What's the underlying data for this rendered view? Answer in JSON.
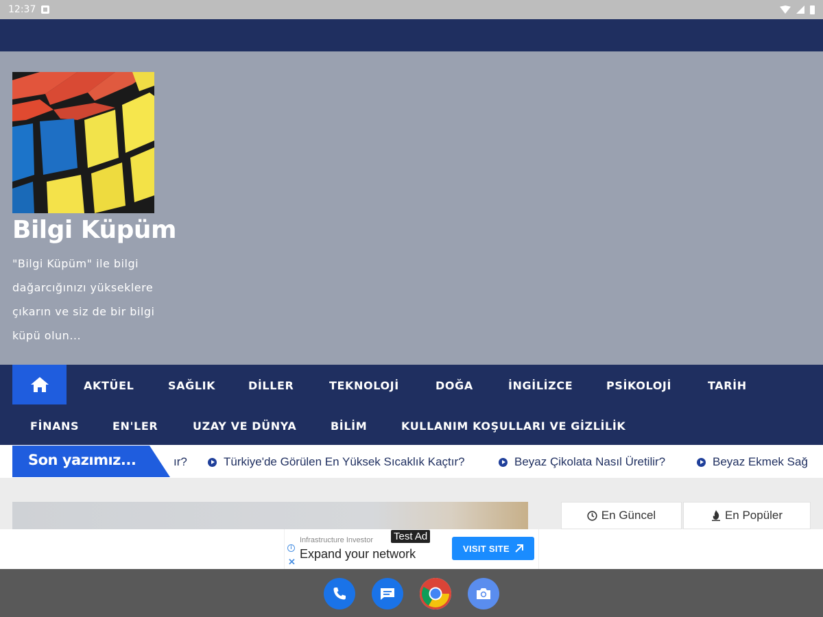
{
  "status_bar": {
    "time": "12:37"
  },
  "site": {
    "title": "Bilgi Küpüm",
    "description": "\"Bilgi Küpüm\" ile bilgi dağarcığınızı yükseklere çıkarın ve siz de bir bilgi küpü olun..."
  },
  "nav": {
    "items": [
      "AKTÜEL",
      "SAĞLIK",
      "DİLLER",
      "TEKNOLOJİ",
      "DOĞA",
      "İNGİLİZCE",
      "PSİKOLOJİ",
      "TARİH",
      "FİNANS",
      "EN'LER",
      "UZAY VE DÜNYA",
      "BİLİM",
      "KULLANIM KOŞULLARI VE GİZLİLİK"
    ]
  },
  "ticker": {
    "label": "Son yazımız...",
    "fragment": "ır?",
    "items": [
      "Türkiye'de Görülen En Yüksek Sıcaklık Kaçtır?",
      "Beyaz Çikolata Nasıl Üretilir?",
      "Beyaz Ekmek Sağ"
    ]
  },
  "sidebar_tabs": {
    "latest": "En Güncel",
    "popular": "En Popüler"
  },
  "ad": {
    "advertiser": "Infrastructure Investor",
    "headline": "Expand your network",
    "cta": "VISIT SITE",
    "test_label": "Test Ad"
  },
  "colors": {
    "navy": "#1f2f60",
    "accent_blue": "#1f5dde",
    "hero_gray": "#9aa1b0"
  }
}
